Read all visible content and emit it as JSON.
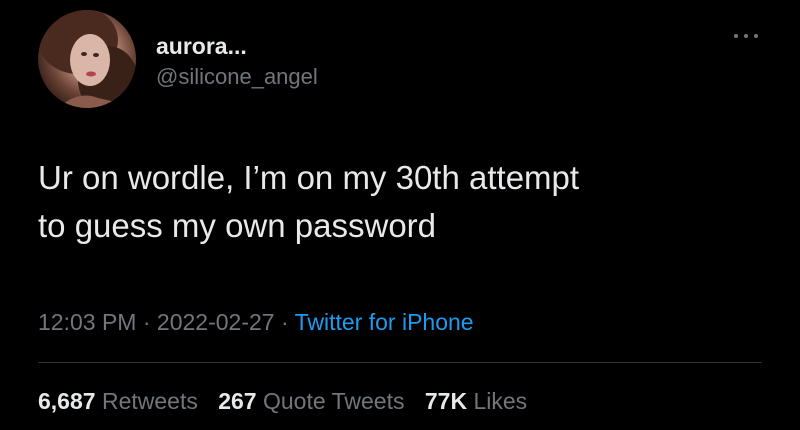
{
  "author": {
    "display_name": "aurora...",
    "handle": "@silicone_angel"
  },
  "menu": {
    "icon": "more-horizontal-icon"
  },
  "tweet": {
    "line1": "Ur on wordle, I’m on my 30th attempt",
    "line2": "to guess my own password"
  },
  "meta": {
    "time": "12:03 PM",
    "separator": "·",
    "date": "2022-02-27",
    "source": "Twitter for iPhone"
  },
  "stats": {
    "retweets_count": "6,687",
    "retweets_label": "Retweets",
    "quotes_count": "267",
    "quotes_label": "Quote Tweets",
    "likes_count": "77K",
    "likes_label": "Likes"
  },
  "colors": {
    "background": "#000000",
    "text_primary": "#e7e9ea",
    "text_secondary": "#71767b",
    "link": "#1d9bf0",
    "divider": "#2f3336"
  }
}
